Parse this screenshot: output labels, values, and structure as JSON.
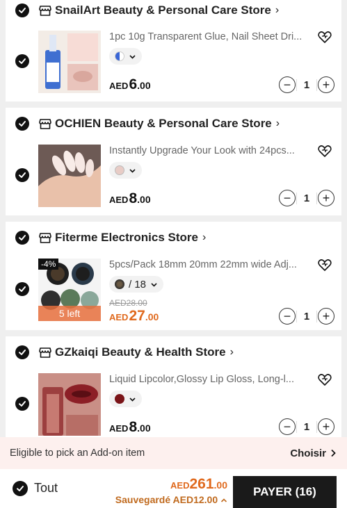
{
  "stores": [
    {
      "name": "SnailArt Beauty & Personal Care Store",
      "item": {
        "title": "1pc 10g Transparent Glue, Nail Sheet Dri...",
        "variant_text": "",
        "swatch_color": "#3a66d6",
        "currency": "AED",
        "price_int": "6",
        "price_dec": ".00",
        "quantity": "1"
      }
    },
    {
      "name": "OCHIEN Beauty & Personal Care Store",
      "item": {
        "title": "Instantly Upgrade Your Look with 24pcs...",
        "variant_text": "",
        "swatch_color": "#e8ccc6",
        "currency": "AED",
        "price_int": "8",
        "price_dec": ".00",
        "quantity": "1"
      }
    },
    {
      "name": "Fiterme Electronics Store",
      "item": {
        "title": "5pcs/Pack 18mm 20mm 22mm wide Adj...",
        "variant_text": "/ 18",
        "swatch_color": "#6b5a44",
        "discount": "-4%",
        "stock": "5 left",
        "old_price": "AED28.00",
        "currency": "AED",
        "price_int": "27",
        "price_dec": ".00",
        "quantity": "1"
      }
    },
    {
      "name": "GZkaiqi Beauty & Health Store",
      "item": {
        "title": "Liquid Lipcolor,Glossy Lip Gloss, Long-l...",
        "variant_text": "",
        "swatch_color": "#7a1418",
        "currency": "AED",
        "price_int": "8",
        "price_dec": ".00",
        "quantity": "1"
      }
    }
  ],
  "qty_minus": "−",
  "qty_plus": "+",
  "addon": {
    "text": "Eligible to pick an Add-on item",
    "link": "Choisir"
  },
  "footer": {
    "all_label": "Tout",
    "total_currency": "AED",
    "total_int": "261",
    "total_dec": ".00",
    "saved": "Sauvegardé AED12.00",
    "pay_label": "PAYER (16)"
  },
  "colors": {
    "accent_orange": "#e06a1e",
    "pay_button": "#1a1a1a",
    "addon_bg": "#fdf0ee"
  }
}
